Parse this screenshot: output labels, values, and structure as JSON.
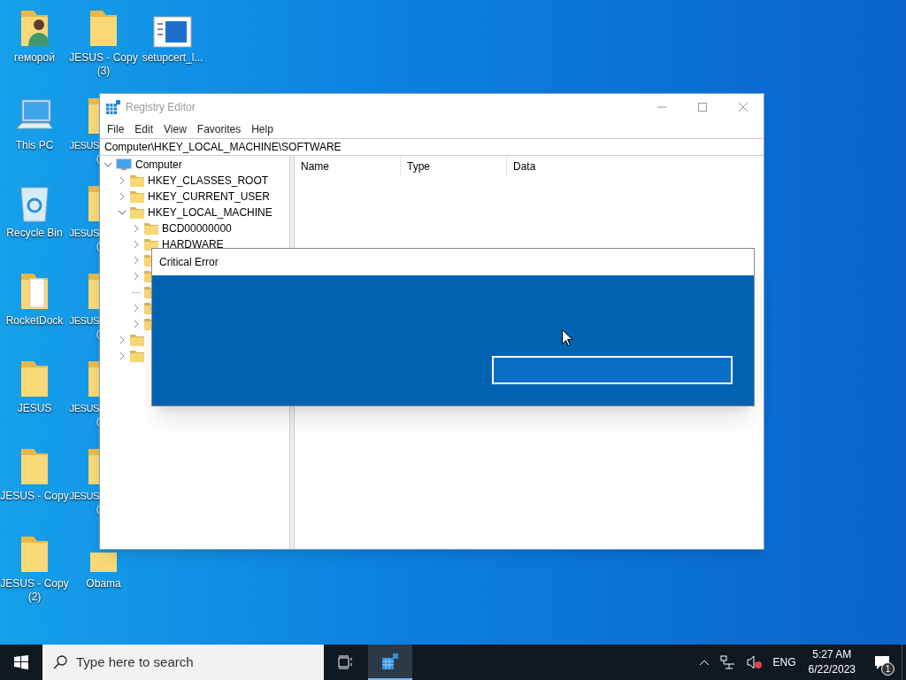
{
  "desktop_icons": [
    {
      "kind": "user-folder",
      "label": "геморой"
    },
    {
      "kind": "pc",
      "label": "This PC"
    },
    {
      "kind": "recycle",
      "label": "Recycle Bin"
    },
    {
      "kind": "doc-folder",
      "label": "RocketDock"
    },
    {
      "kind": "folder",
      "label": "JESUS"
    },
    {
      "kind": "folder",
      "label": "JESUS - Copy"
    },
    {
      "kind": "folder",
      "label": "JESUS - Copy",
      "label_line2": "(2)"
    },
    {
      "kind": "folder",
      "label": "JESUS - Copy",
      "label_line2": "(3)"
    },
    {
      "kind": "folder-covered-right",
      "label": "JESUS",
      "label_line2": "("
    },
    {
      "kind": "folder-covered-right",
      "label": "JESUS",
      "label_line2": "("
    },
    {
      "kind": "folder-covered-right",
      "label": "JESUS",
      "label_line2": "("
    },
    {
      "kind": "folder-covered-right",
      "label": "JESUS",
      "label_line2": "("
    },
    {
      "kind": "folder-covered-right",
      "label": "JESUS",
      "label_line2": "("
    },
    {
      "kind": "folder-covered-top",
      "label": "Obama"
    },
    {
      "kind": "app",
      "label": "setupcert_l..."
    }
  ],
  "registry_window": {
    "title": "Registry Editor",
    "menu": [
      "File",
      "Edit",
      "View",
      "Favorites",
      "Help"
    ],
    "address": "Computer\\HKEY_LOCAL_MACHINE\\SOFTWARE",
    "tree": {
      "label": "Computer",
      "expanded": true,
      "children": [
        {
          "label": "HKEY_CLASSES_ROOT",
          "expanded": false
        },
        {
          "label": "HKEY_CURRENT_USER",
          "expanded": false
        },
        {
          "label": "HKEY_LOCAL_MACHINE",
          "expanded": true,
          "children": [
            {
              "label": "BCD00000000",
              "expanded": false
            },
            {
              "label": "HARDWARE",
              "expanded": false
            },
            {
              "expanded": false
            },
            {
              "expanded": false
            },
            {
              "leaf": true
            },
            {
              "expanded": false
            },
            {
              "expanded": false
            }
          ]
        },
        {
          "expanded": false
        },
        {
          "expanded": false
        }
      ]
    },
    "columns": [
      "Name",
      "Type",
      "Data"
    ]
  },
  "dialog": {
    "title": "Critical Error"
  },
  "taskbar": {
    "search_placeholder": "Type here to search",
    "apps": [
      {
        "kind": "task-view",
        "selected": false
      },
      {
        "kind": "regedit",
        "selected": true
      }
    ],
    "language": "ENG",
    "time": "5:27 AM",
    "date": "6/22/2023",
    "notifications": "1"
  }
}
